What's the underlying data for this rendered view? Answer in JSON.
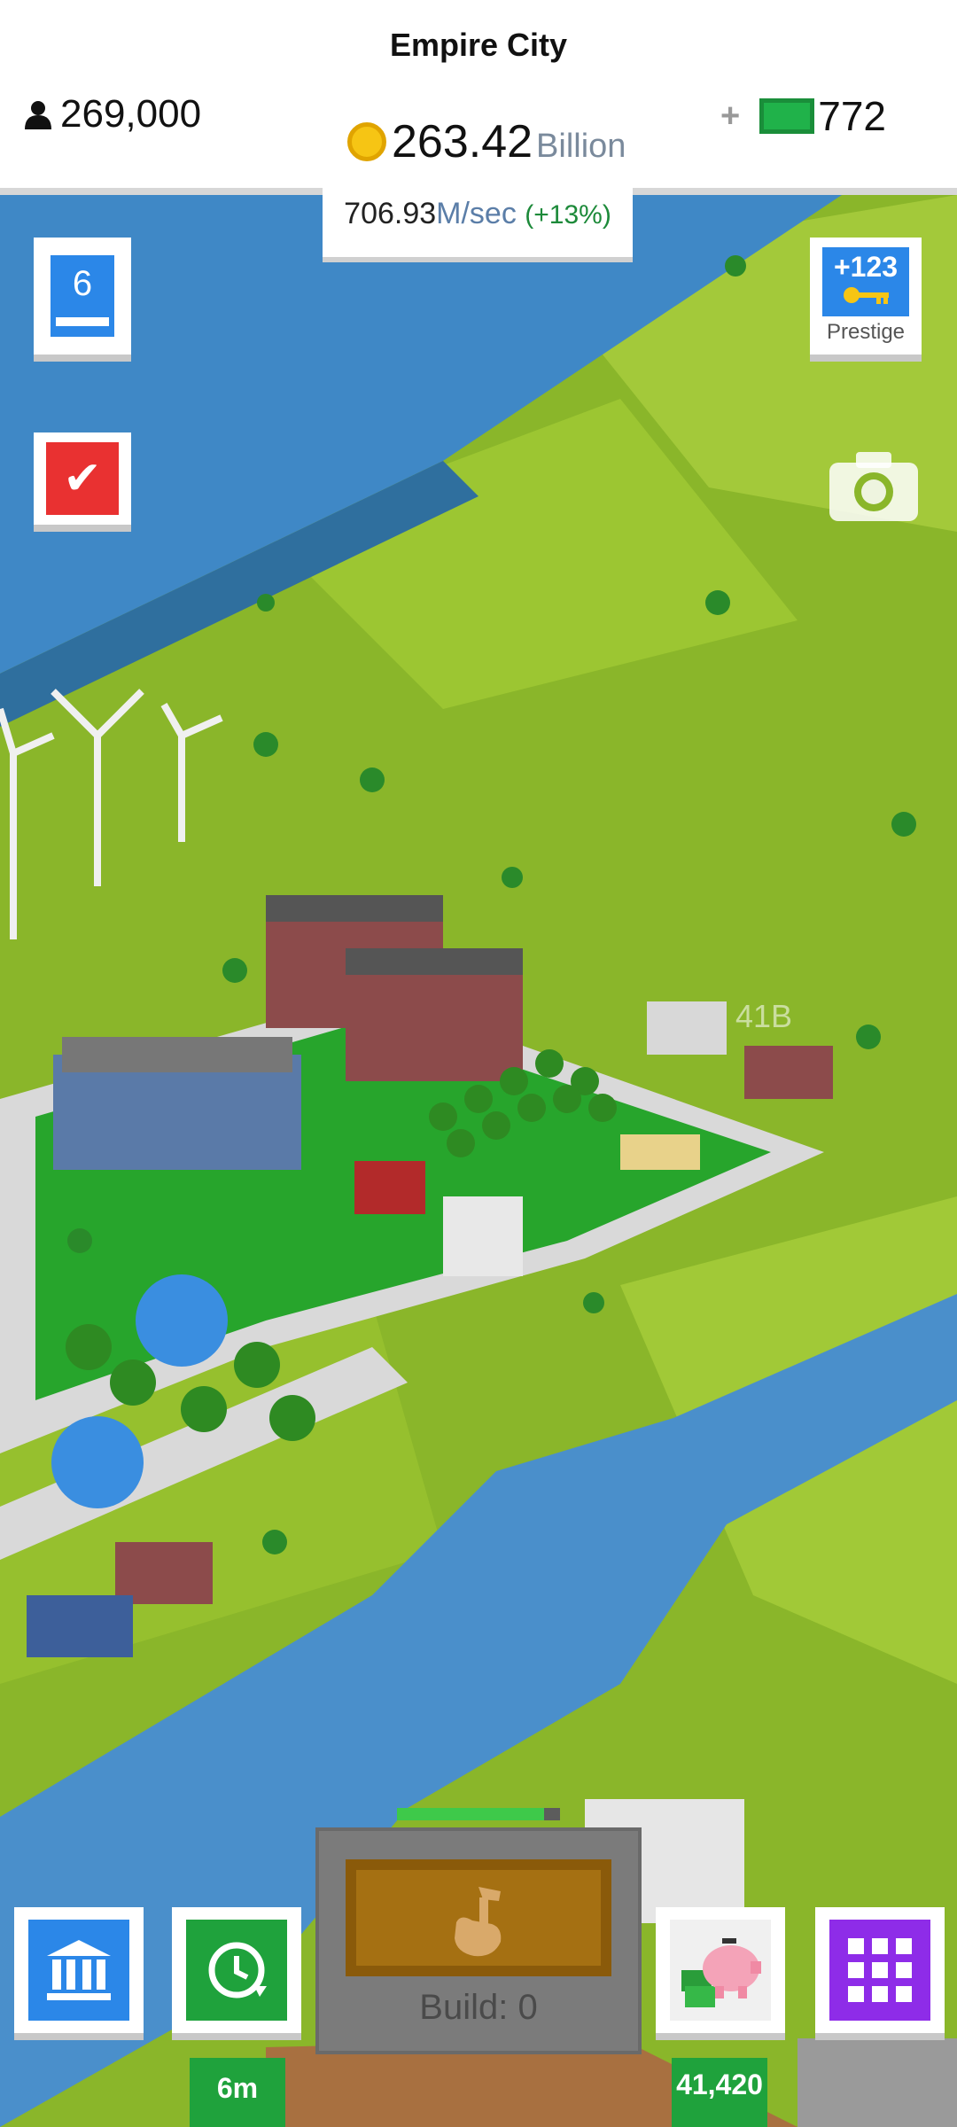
{
  "header": {
    "city_name": "Empire City",
    "population": "269,000",
    "money_value": "263.42",
    "money_unit": "Billion",
    "gems_plus": "+",
    "gems": "772"
  },
  "income": {
    "value": "706.93",
    "unit": "M/sec",
    "bonus": "(+13%)"
  },
  "left_buttons": {
    "level": "6",
    "task_icon": "checkmark-icon"
  },
  "prestige": {
    "amount": "+123",
    "label": "Prestige",
    "icon": "key-icon"
  },
  "map": {
    "building_value": "41B"
  },
  "build": {
    "label": "Build: 0",
    "progress": 0.9,
    "icon": "hammer-icon"
  },
  "bottom_bar": {
    "bank_icon": "bank-icon",
    "timer_icon": "clock-icon",
    "timer_label": "6m",
    "piggy_icon": "piggy-bank-icon",
    "piggy_label": "41,420",
    "menu_icon": "grid-icon"
  },
  "colors": {
    "grass": "#8ab62a",
    "water": "#3f88c6",
    "accent_blue": "#2b87e8",
    "accent_green": "#1fa23c",
    "accent_red": "#e93131",
    "accent_purple": "#8e2ce8"
  }
}
